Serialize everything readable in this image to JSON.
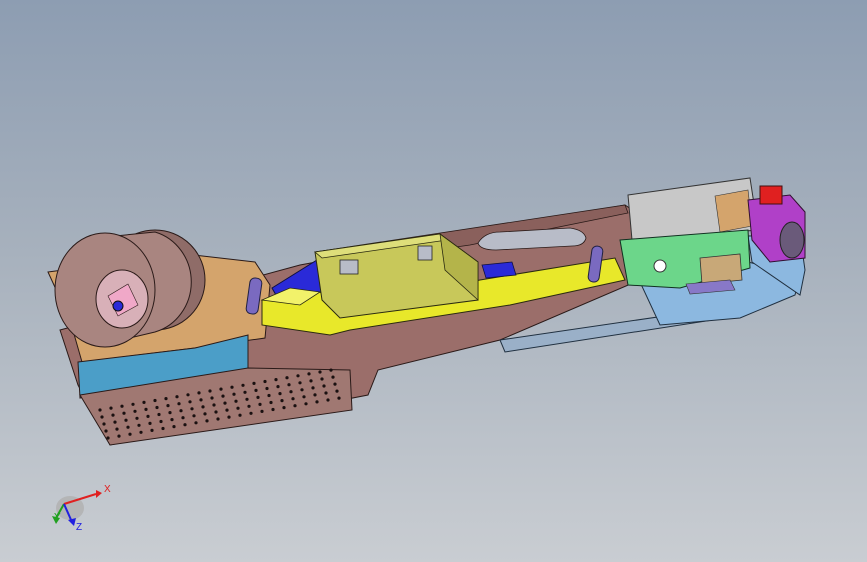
{
  "viewport": {
    "background_top": "#8d9db2",
    "background_bottom": "#c9cdd2"
  },
  "model": {
    "parts": [
      {
        "name": "base-plate",
        "color": "#9b6e6a"
      },
      {
        "name": "tape-reel",
        "color": "#a98580"
      },
      {
        "name": "perforated-guard",
        "color": "#a07872"
      },
      {
        "name": "blue-cover",
        "color": "#4b9ec8"
      },
      {
        "name": "tan-block",
        "color": "#d4a46c"
      },
      {
        "name": "yellow-channel",
        "color": "#e8e82a"
      },
      {
        "name": "olive-housing",
        "color": "#c8c85a"
      },
      {
        "name": "blue-wedge",
        "color": "#2a2ad8"
      },
      {
        "name": "purple-roller",
        "color": "#7a6ac0"
      },
      {
        "name": "green-pcb",
        "color": "#6cd68a"
      },
      {
        "name": "light-blue-bracket",
        "color": "#8cb8e0"
      },
      {
        "name": "gray-slide-rail",
        "color": "#9ab0c8"
      },
      {
        "name": "magenta-motor",
        "color": "#b040c8"
      },
      {
        "name": "red-connector",
        "color": "#e02020"
      }
    ]
  },
  "triad": {
    "x_label": "X",
    "y_label": "Y",
    "z_label": "Z",
    "x_color": "#e02020",
    "y_color": "#20a020",
    "z_color": "#2020e0"
  }
}
